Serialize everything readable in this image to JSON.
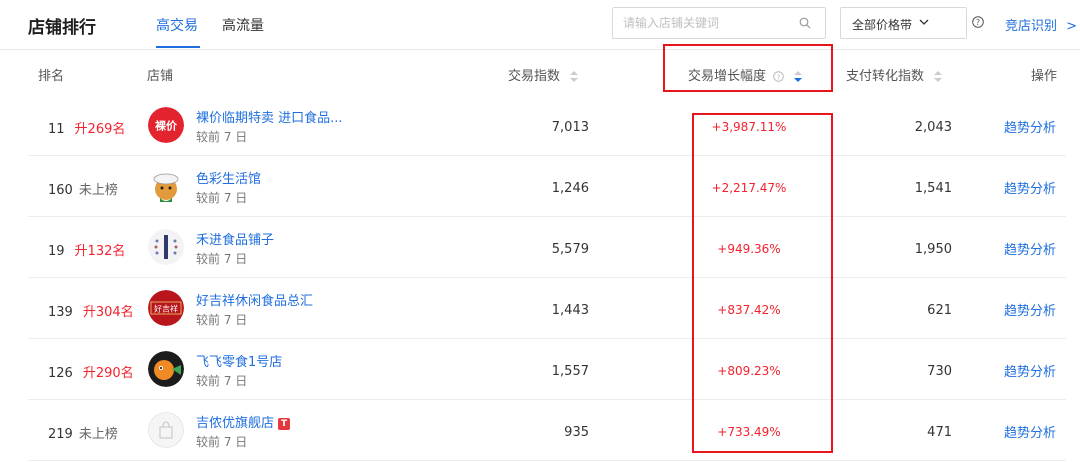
{
  "header": {
    "title": "店铺排行",
    "tabs": [
      {
        "label": "高交易",
        "active": true
      },
      {
        "label": "高流量",
        "active": false
      }
    ],
    "search_placeholder": "请输入店铺关键词",
    "price_filter": "全部价格带",
    "competitor_link": "竞店识别",
    "accent_color": "#1f6fde"
  },
  "columns": {
    "rank": "排名",
    "shop": "店铺",
    "trade_index": "交易指数",
    "trade_growth": "交易增长幅度",
    "pay_conversion": "支付转化指数",
    "action": "操作"
  },
  "rows": [
    {
      "rank": "11",
      "change": "升269名",
      "name": "裸价临期特卖 进口食品...",
      "sub": "较前 7 日",
      "trade": "7,013",
      "growth": "+3,987.11%",
      "pay": "2,043",
      "action": "趋势分析",
      "avatar_text": "裸价"
    },
    {
      "rank": "160",
      "change": "未上榜",
      "name": "色彩生活馆",
      "sub": "较前 7 日",
      "trade": "1,246",
      "growth": "+2,217.47%",
      "pay": "1,541",
      "action": "趋势分析"
    },
    {
      "rank": "19",
      "change": "升132名",
      "name": "禾进食品铺子",
      "sub": "较前 7 日",
      "trade": "5,579",
      "growth": "+949.36%",
      "pay": "1,950",
      "action": "趋势分析"
    },
    {
      "rank": "139",
      "change": "升304名",
      "name": "好吉祥休闲食品总汇",
      "sub": "较前 7 日",
      "trade": "1,443",
      "growth": "+837.42%",
      "pay": "621",
      "action": "趋势分析",
      "avatar_text": "好吉祥"
    },
    {
      "rank": "126",
      "change": "升290名",
      "name": "飞飞零食1号店",
      "sub": "较前 7 日",
      "trade": "1,557",
      "growth": "+809.23%",
      "pay": "730",
      "action": "趋势分析"
    },
    {
      "rank": "219",
      "change": "未上榜",
      "name": "吉侬优旗舰店",
      "sub": "较前 7 日",
      "trade": "935",
      "growth": "+733.49%",
      "pay": "471",
      "action": "趋势分析",
      "badge": "T"
    }
  ],
  "colors": {
    "up": "#f5222d",
    "growth": "#f5222d",
    "highlight_box": "#e8161c"
  }
}
